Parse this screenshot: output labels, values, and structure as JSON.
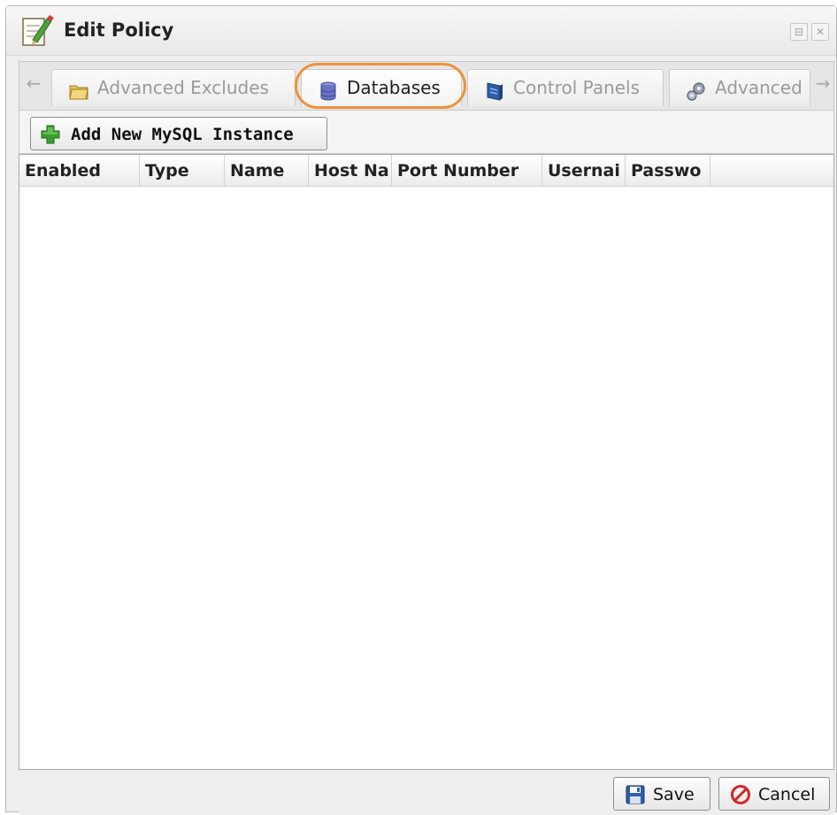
{
  "window": {
    "title": "Edit Policy",
    "icons": {
      "title": "edit-document-icon",
      "restore": "restore-icon",
      "close": "close-icon"
    },
    "restore_glyph": "⊟",
    "close_glyph": "✕"
  },
  "tabs": {
    "scroll_left_glyph": "←",
    "scroll_right_glyph": "→",
    "items": [
      {
        "label": "Advanced Excludes",
        "icon": "folder-icon",
        "active": false
      },
      {
        "label": "Databases",
        "icon": "database-icon",
        "active": true
      },
      {
        "label": "Control Panels",
        "icon": "control-panel-icon",
        "active": false
      },
      {
        "label": "Advanced",
        "icon": "gears-icon",
        "active": false
      }
    ],
    "highlight_color": "#f0923a"
  },
  "toolbar": {
    "add_label": "Add New MySQL Instance",
    "add_icon": "plus-icon"
  },
  "grid": {
    "columns": [
      "Enabled",
      "Type",
      "Name",
      "Host Na",
      "Port Number",
      "Usernai",
      "Passwo"
    ],
    "rows": []
  },
  "footer": {
    "save_label": "Save",
    "save_icon": "floppy-disk-icon",
    "cancel_label": "Cancel",
    "cancel_icon": "cancel-icon"
  },
  "colors": {
    "accent_orange": "#f0923a",
    "plus_green": "#3a9e2f",
    "cancel_red": "#d42424",
    "save_blue": "#2f5fa8"
  }
}
